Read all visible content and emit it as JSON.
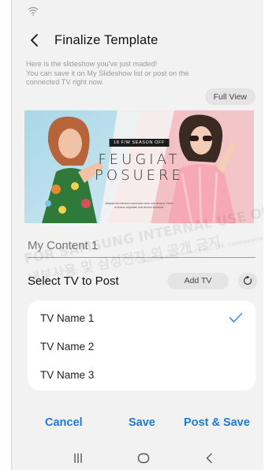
{
  "header": {
    "title": "Finalize Template"
  },
  "description": [
    "Here is the slideshow you've just maded!",
    "You can save it on My Slideshow list or post on the",
    "connected TV right now."
  ],
  "full_view_label": "Full View",
  "template": {
    "season": "18 F/W SEASON OFF",
    "brand_line1": "FEUGIAT",
    "brand_line2": "POSUERE",
    "small_text": "Aliquam fermentum commodo nunc non tempor. Nunc et lectus vulputate erat dictum tincidunt."
  },
  "content_field": {
    "placeholder": "My Content 1"
  },
  "watermark": {
    "line1": "FOR SAMSUNG INTERNAL USE ONLY",
    "line2": "내부사용 및 삼성전자 외 공개 금지",
    "line3": "SAMSUNG ELECTRONICS CO., LTD. CONFIDENTIAL"
  },
  "select_tv": {
    "label": "Select TV to Post",
    "add_tv_label": "Add TV",
    "items": [
      {
        "name": "TV Name 1",
        "selected": true
      },
      {
        "name": "TV Name 2",
        "selected": false
      },
      {
        "name": "TV Name 3",
        "selected": false
      }
    ]
  },
  "actions": {
    "cancel": "Cancel",
    "save": "Save",
    "post_save": "Post & Save"
  },
  "colors": {
    "accent": "#1f79d4",
    "check": "#3b8ee0"
  },
  "icons": [
    "wifi-icon",
    "back-arrow-icon",
    "refresh-icon",
    "check-icon",
    "recent-apps-icon",
    "home-icon",
    "nav-back-icon"
  ]
}
